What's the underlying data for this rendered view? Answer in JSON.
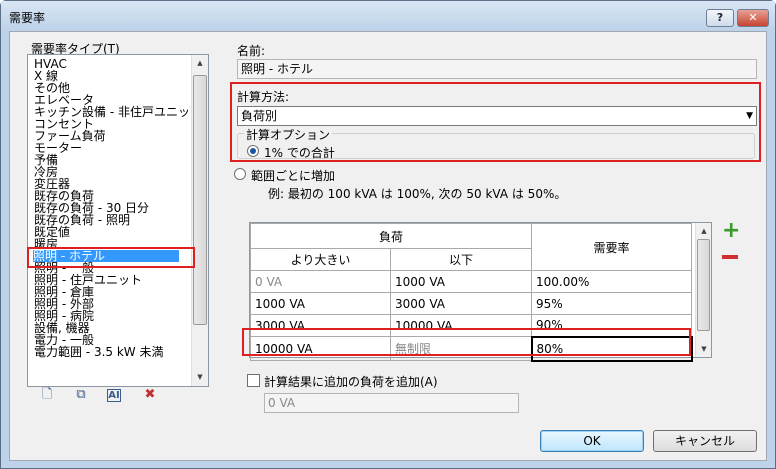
{
  "window": {
    "title": "需要率",
    "help": "?",
    "close": "✕"
  },
  "left": {
    "label": "需要率タイプ(T)",
    "items": [
      "HVAC",
      "X 線",
      "その他",
      "エレベータ",
      "キッチン設備 - 非住戸ユニット",
      "コンセント",
      "ファーム負荷",
      "モーター",
      "予備",
      "冷房",
      "変圧器",
      "既存の負荷",
      "既存の負荷 - 30 日分",
      "既存の負荷 - 照明",
      "既定値",
      "暖房",
      "照明 - ホテル",
      "照明 - 一般",
      "照明 - 住戸ユニット",
      "照明 - 倉庫",
      "照明 - 外部",
      "照明 - 病院",
      "設備, 機器",
      "電力 - 一般",
      "電力範囲 - 3.5 kW 未満"
    ],
    "selected_index": 16,
    "toolbar_icons": [
      "new-icon",
      "duplicate-icon",
      "rename-icon",
      "delete-icon"
    ]
  },
  "name_section": {
    "label": "名前:",
    "value": "照明 - ホテル"
  },
  "method": {
    "label": "計算方法:",
    "value": "負荷別",
    "options_label": "計算オプション",
    "option1": "1% での合計",
    "option2": "範囲ごとに増加",
    "example": "例: 最初の 100 kVA は 100%, 次の 50 kVA は 50%。"
  },
  "table": {
    "header_load": "負荷",
    "header_greater": "より大きい",
    "header_upto": "以下",
    "header_factor": "需要率",
    "rows": [
      {
        "from": "0 VA",
        "to": "1000 VA",
        "factor": "100.00%"
      },
      {
        "from": "1000 VA",
        "to": "3000 VA",
        "factor": "95%"
      },
      {
        "from": "3000 VA",
        "to": "10000 VA",
        "factor": "90%"
      },
      {
        "from": "10000 VA",
        "to": "無制限",
        "factor": "80%"
      }
    ],
    "add_icon": "plus-icon",
    "remove_icon": "minus-icon"
  },
  "additional": {
    "checkbox_label": "計算結果に追加の負荷を追加(A)",
    "value": "0 VA"
  },
  "buttons": {
    "ok": "OK",
    "cancel": "キャンセル"
  },
  "colors": {
    "highlight": "#e02020",
    "selection": "#3399ff",
    "add": "#3a9a2a",
    "remove": "#d03030"
  }
}
